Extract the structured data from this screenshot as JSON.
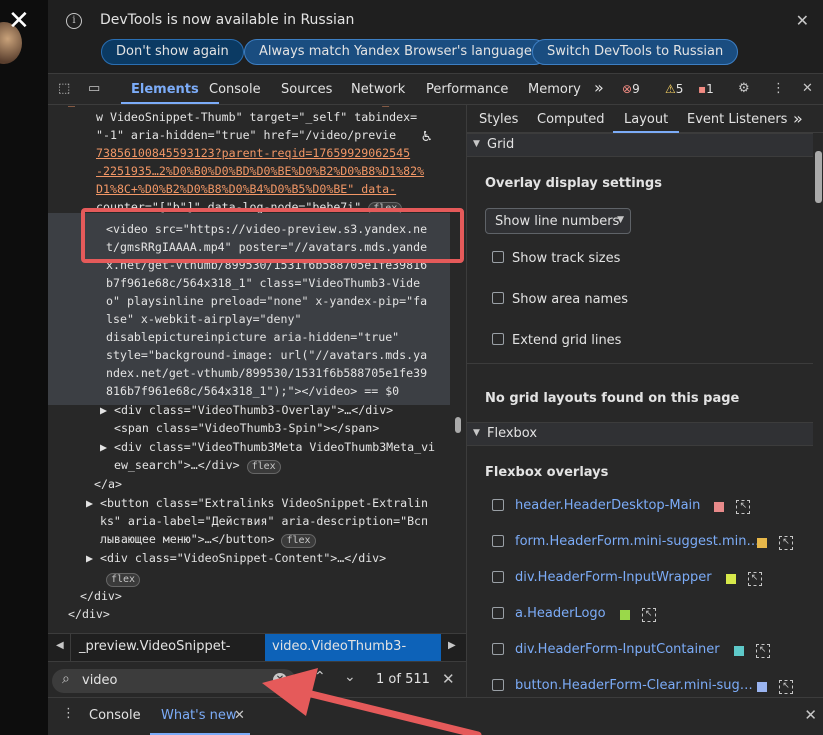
{
  "infobar": {
    "message": "DevTools is now available in Russian",
    "buttons": [
      "Don't show again",
      "Always match Yandex Browser's language",
      "Switch DevTools to Russian"
    ]
  },
  "toolbar": {
    "tabs": [
      "Elements",
      "Console",
      "Sources",
      "Network",
      "Performance",
      "Memory"
    ],
    "more": "»",
    "errors": "9",
    "warnings": "5",
    "issues": "1"
  },
  "elements": {
    "lines": [
      {
        "pre": "w VideoSnippet-Thumb\" target=\"_self\" tabindex="
      },
      {
        "pre": "\"-1\" aria-hidden=\"true\" href=\"/video/previe"
      },
      {
        "pre": "73856100845593123?parent-reqid=17659929062545"
      },
      {
        "pre": "-2251935…2%D0%B0%D0%BD%D0%BE%D0%B2%D0%B8%D1%82%"
      },
      {
        "pre": "D1%8C+%D0%B2%D0%B8%D0%B4%D0%B5%D0%BE\" data-"
      },
      {
        "pre": "counter=\"[\"b\"]\" data-log-node=\"bebe7i\""
      },
      {
        "pre": "<video src=\"https://video-preview.s3.yandex.net/gmsRRgIAAAA.mp4\" poster=\"//avatars.mds.yandex.net/get-vthumb/899530/1531f6b588705e1fe39816b7f961e68c/564x318_1\""
      },
      {
        "pre": ""
      }
    ],
    "video_block": [
      "<video src=\"https://video-preview.s3.yandex.ne",
      "t/gmsRRgIAAAA.mp4\" poster=\"//avatars.mds.yande",
      "x.net/get-vthumb/899530/1531f6b588705e1fe39816",
      "b7f961e68c/564x318_1\" class=\"VideoThumb3-Vide",
      "o\" playsinline preload=\"none\" x-yandex-pip=\"fa",
      "lse\" x-webkit-airplay=\"deny\"",
      "disablepictureinpicture aria-hidden=\"true\"",
      "style=\"background-image: url(\"//avatars.mds.ya",
      "ndex.net/get-vthumb/899530/1531f6b588705e1fe39",
      "816b7f961e68c/564x318_1\");\"></video> == $0"
    ],
    "after": [
      "▶ <div class=\"VideoThumb3-Overlay\">…</div>",
      "  <span class=\"VideoThumb3-Spin\"></span>",
      "▶ <div class=\"VideoThumb3Meta VideoThumb3Meta_vi",
      "  ew_search\">…</div>",
      "</a>",
      "▶ <button class=\"Extralinks VideoSnippet-Extralin",
      "  ks\" aria-label=\"Действия\" aria-description=\"Всп",
      "  лывающее меню\">…</button>",
      "▶ <div class=\"VideoSnippet-Content\">…</div>",
      "</div>",
      "</div>"
    ],
    "flex": "flex"
  },
  "breadcrumb": {
    "items": [
      "_preview.VideoSnippet-Thumb",
      "video.VideoThumb3-Video"
    ]
  },
  "search": {
    "value": "video",
    "count": "1 of 511"
  },
  "drawer": {
    "tabs": [
      "Console",
      "What's new"
    ]
  },
  "side": {
    "tabs": [
      "Styles",
      "Computed",
      "Layout",
      "Event Listeners"
    ],
    "grid_section": "Grid",
    "overlay_title": "Overlay display settings",
    "select": "Show line numbers",
    "checks": [
      "Show track sizes",
      "Show area names",
      "Extend grid lines"
    ],
    "no_grid": "No grid layouts found on this page",
    "flex_section": "Flexbox",
    "flex_title": "Flexbox overlays",
    "flex_items": [
      {
        "name": "header.HeaderDesktop-Main",
        "color": "#e88a8a"
      },
      {
        "name": "form.HeaderForm.mini-suggest.min…",
        "color": "#e8b84a"
      },
      {
        "name": "div.HeaderForm-InputWrapper",
        "color": "#d7e84a"
      },
      {
        "name": "a.HeaderLogo",
        "color": "#9ad84a"
      },
      {
        "name": "div.HeaderForm-InputContainer",
        "color": "#5ec9c9"
      },
      {
        "name": "button.HeaderForm-Clear.mini-sug…",
        "color": "#9ab4f0"
      }
    ]
  }
}
